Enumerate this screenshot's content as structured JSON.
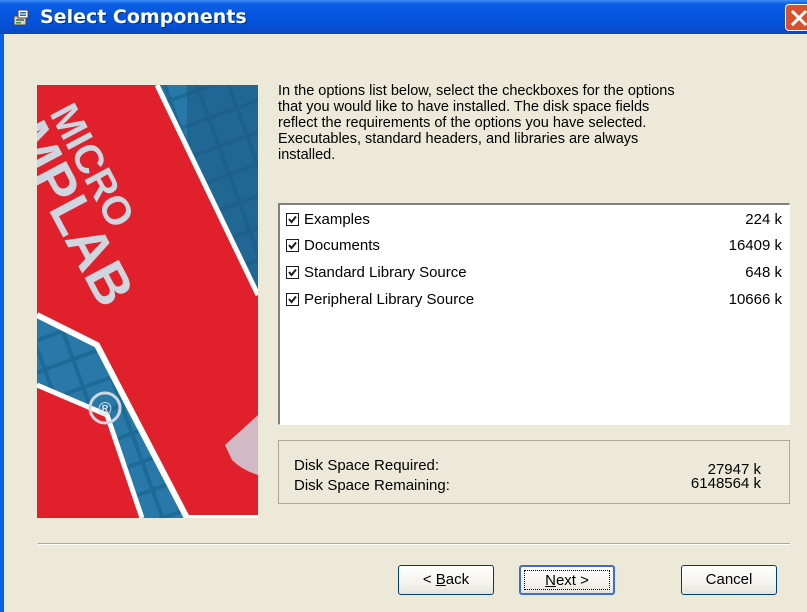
{
  "window": {
    "title": "Select Components"
  },
  "description": "In the options list below, select the checkboxes for the options\nthat you would like to have installed.  The disk space fields\nreflect the requirements of the options you have selected.\nExecutables, standard headers, and libraries are always\ninstalled.",
  "banner": {
    "logo_text_1": "MICRO",
    "logo_text_2": "MPLAB",
    "registered_mark": "®"
  },
  "components": [
    {
      "label": "Examples",
      "size": "224 k",
      "checked": true
    },
    {
      "label": "Documents",
      "size": "16409 k",
      "checked": true
    },
    {
      "label": "Standard Library Source",
      "size": "648 k",
      "checked": true
    },
    {
      "label": "Peripheral Library Source",
      "size": "10666 k",
      "checked": true
    }
  ],
  "disk": {
    "required_label": "Disk Space Required:",
    "required_value": "27947 k",
    "remaining_label": "Disk Space Remaining:",
    "remaining_value": "6148564 k"
  },
  "buttons": {
    "back_prefix": "< ",
    "back_accel": "B",
    "back_rest": "ack",
    "next_accel": "N",
    "next_rest": "ext >",
    "cancel": "Cancel"
  },
  "colors": {
    "titlebar": "#0654de",
    "close": "#d8502c",
    "banner_red": "#e0202a",
    "banner_blue": "#1b5f8a"
  }
}
